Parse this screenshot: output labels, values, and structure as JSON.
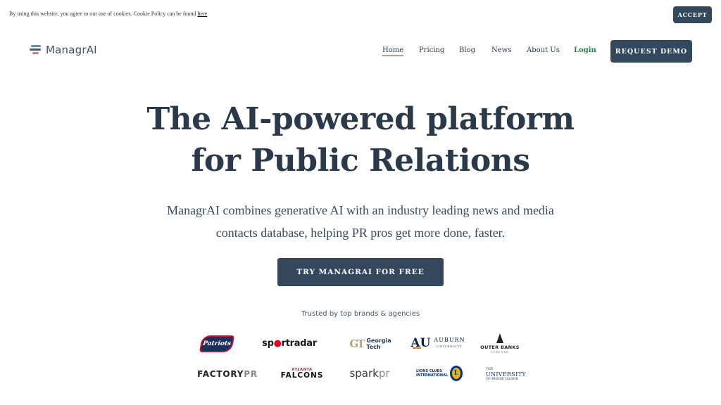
{
  "cookie": {
    "text": "By using this website, you agree to our use of cookies. Cookie Policy can be found ",
    "link": "here",
    "accept_label": "ACCEPT"
  },
  "header": {
    "logo_text": "ManagrAI",
    "nav": [
      {
        "label": "Home",
        "active": true
      },
      {
        "label": "Pricing"
      },
      {
        "label": "Blog"
      },
      {
        "label": "News"
      },
      {
        "label": "About Us"
      },
      {
        "label": "Login"
      }
    ],
    "demo_label": "REQUEST DEMO"
  },
  "hero": {
    "title_line1": "The AI-powered platform",
    "title_line2": "for Public Relations",
    "subtitle_line1": "ManagrAI combines generative AI with an industry leading news and media",
    "subtitle_line2": "contacts database, helping PR pros get more done, faster.",
    "cta_label": "TRY MANAGRAI FOR FREE",
    "trusted_label": "Trusted by top brands & agencies"
  },
  "brands": {
    "patriots": "Patriots",
    "sportradar_a": "sp",
    "sportradar_b": "rtradar",
    "gatech_mark": "GT",
    "gatech_name_1": "Georgia",
    "gatech_name_2": "Tech",
    "auburn_mark": "AU",
    "auburn_name": "AUBURN",
    "auburn_sub": "UNIVERSITY",
    "outerbanks": "OUTER BANKS",
    "outerbanks_sub": "FOREVER",
    "factory_a": "FACTORY",
    "factory_b": "PR",
    "falcons_top": "ATLANTA",
    "falcons_main": "FALCONS",
    "spark_a": "spark",
    "spark_b": "pr",
    "lions_1": "LIONS CLUBS",
    "lions_2": "INTERNATIONAL",
    "lions_badge": "L",
    "uri_the": "THE",
    "uri_main": "UNIVERSITY",
    "uri_sub": "OF RHODE ISLAND"
  },
  "colors": {
    "primary_button": "#33485d",
    "heading": "#2a3a4b",
    "login_green": "#1d8a4a"
  }
}
